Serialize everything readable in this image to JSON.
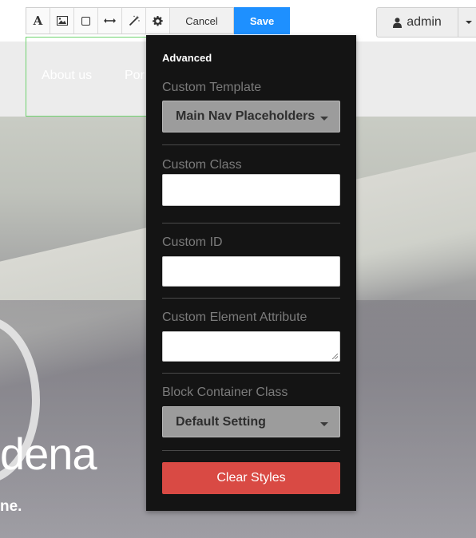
{
  "toolbar": {
    "tools": [
      {
        "name": "text-tool",
        "glyph": "A"
      },
      {
        "name": "image-tool",
        "glyph": "image"
      },
      {
        "name": "box-tool",
        "glyph": "square"
      },
      {
        "name": "spacing-tool",
        "glyph": "arrows"
      },
      {
        "name": "magic-tool",
        "glyph": "wand"
      },
      {
        "name": "settings-tool",
        "glyph": "gear"
      }
    ],
    "cancel_label": "Cancel",
    "save_label": "Save"
  },
  "admin": {
    "label": "admin"
  },
  "nav": {
    "links": [
      "About us",
      "Por"
    ]
  },
  "hero": {
    "title": "dena",
    "subtitle": "ne."
  },
  "panel": {
    "title": "Advanced",
    "custom_template": {
      "label": "Custom Template",
      "value": "Main Nav Placeholders"
    },
    "custom_class": {
      "label": "Custom Class",
      "value": ""
    },
    "custom_id": {
      "label": "Custom ID",
      "value": ""
    },
    "custom_attribute": {
      "label": "Custom Element Attribute",
      "value": ""
    },
    "block_container_class": {
      "label": "Block Container Class",
      "value": "Default Setting"
    },
    "clear_label": "Clear Styles"
  },
  "colors": {
    "save": "#1e90ff",
    "clear": "#d94a44",
    "panel": "#141414"
  }
}
